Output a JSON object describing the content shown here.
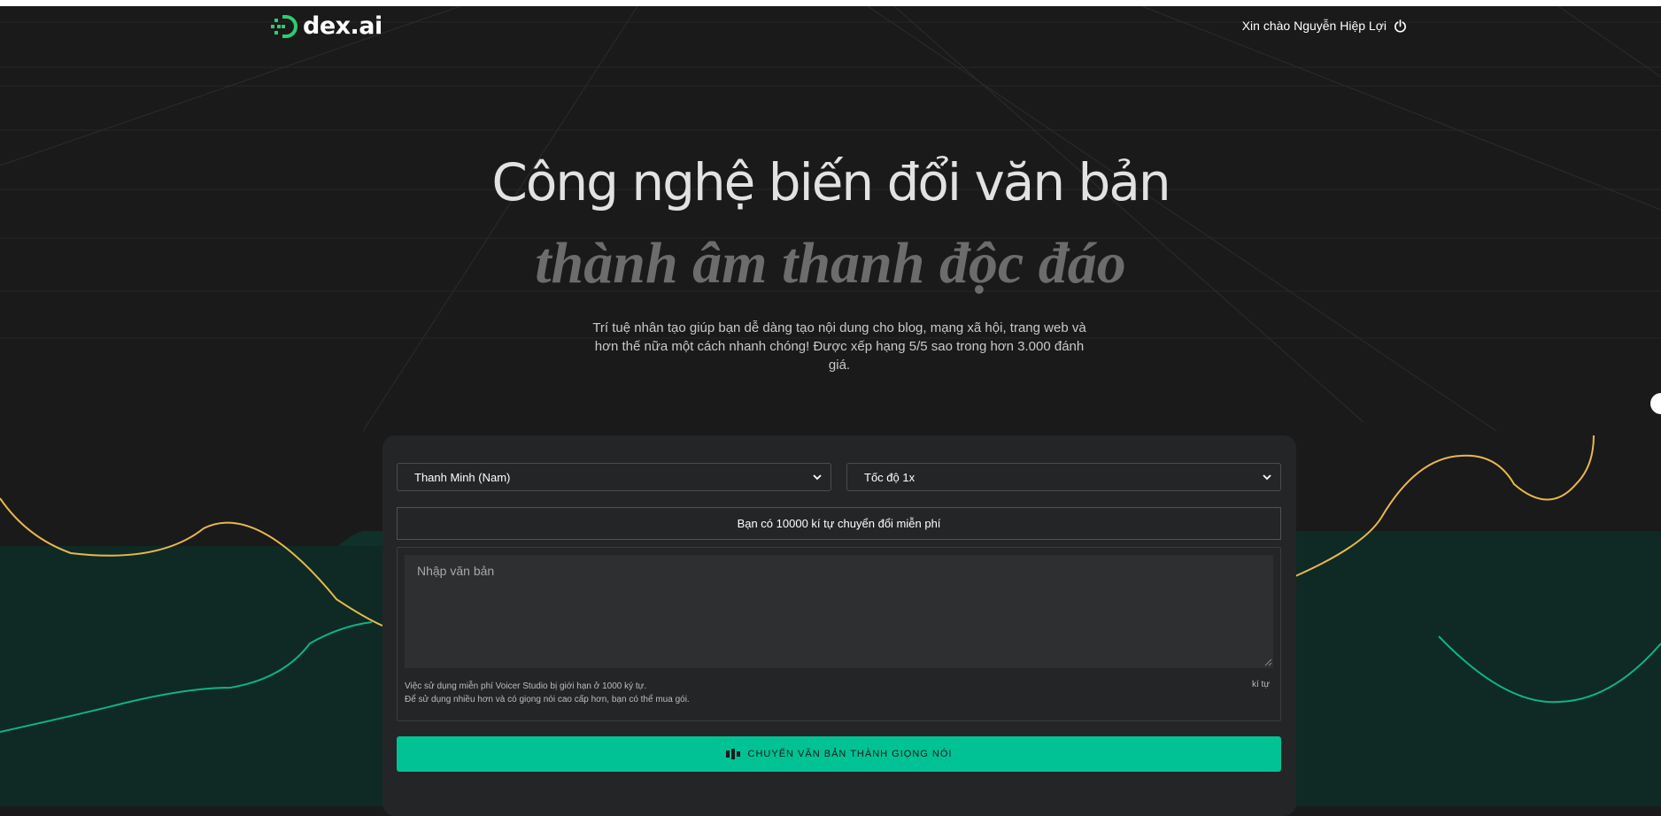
{
  "header": {
    "logo_text": "dex.ai",
    "greeting": "Xin chào Nguyễn Hiệp Lợi",
    "logout_icon": "power-icon"
  },
  "hero": {
    "title": "Công nghệ biến đổi văn bản",
    "subtitle": "thành âm thanh độc đáo",
    "description": "Trí tuệ nhân tạo giúp bạn dễ dàng tạo nội dung cho blog, mạng xã hội, trang web và hơn thế nữa một cách nhanh chóng! Được xếp hạng 5/5 sao trong hơn 3.000 đánh giá."
  },
  "form": {
    "voice_select": "Thanh Minh (Nam)",
    "speed_select": "Tốc độ 1x",
    "free_notice": "Bạn có 10000 kí tự chuyển đổi miễn phí",
    "text_placeholder": "Nhập văn bản",
    "text_value": "",
    "note_line1": "Việc sử dụng miễn phí Voicer Studio bị giới hạn ở 1000 ký tự.",
    "note_line2": "Để sử dụng nhiều hơn và có giọng nói cao cấp hơn, bạn có thể mua gói.",
    "char_count": "kí tự",
    "convert_button": "CHUYỂN VĂN BẢN THÀNH GIỌNG NÓI"
  },
  "colors": {
    "background": "#1a1a1a",
    "panel": "#242526",
    "accent": "#00c295",
    "logo_green": "#2ecc71",
    "wave_yellow": "#e8b84f",
    "wave_green": "#0fb387",
    "teal_band": "#0e2d27"
  }
}
